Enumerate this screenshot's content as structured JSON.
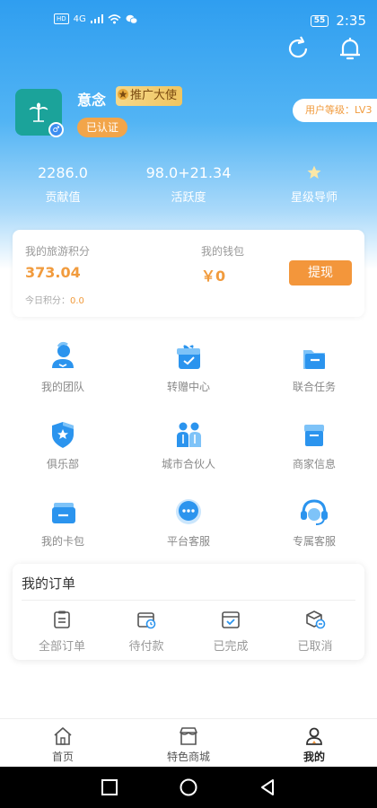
{
  "status_bar": {
    "left_badge": "HD",
    "net": "4G",
    "battery": "55",
    "time": "2:35"
  },
  "header": {
    "refresh_icon": "refresh-icon",
    "bell_icon": "bell-icon"
  },
  "profile": {
    "name": "意念",
    "promo_badge": "推广大使",
    "verified": "已认证",
    "level": "用户等级：LV3",
    "gender": "♂"
  },
  "stats": [
    {
      "value": "2286.0",
      "label": "贡献值"
    },
    {
      "value": "98.0+21.34",
      "label": "活跃度"
    },
    {
      "value": "",
      "label": "星级导师"
    }
  ],
  "wallet": {
    "points_label": "我的旅游积分",
    "points_value": "373.04",
    "wallet_label": "我的钱包",
    "wallet_value": "￥0",
    "today_label": "今日积分：",
    "today_value": "0.0",
    "withdraw": "提现"
  },
  "grid": [
    {
      "label": "我的团队",
      "icon": "team-icon"
    },
    {
      "label": "转赠中心",
      "icon": "gift-icon"
    },
    {
      "label": "联合任务",
      "icon": "folder-icon"
    },
    {
      "label": "俱乐部",
      "icon": "shield-star-icon"
    },
    {
      "label": "城市合伙人",
      "icon": "partners-icon"
    },
    {
      "label": "商家信息",
      "icon": "store-icon"
    },
    {
      "label": "我的卡包",
      "icon": "card-wallet-icon"
    },
    {
      "label": "平台客服",
      "icon": "chat-icon"
    },
    {
      "label": "专属客服",
      "icon": "headset-icon"
    }
  ],
  "orders": {
    "title": "我的订单",
    "items": [
      {
        "label": "全部订单",
        "icon": "clipboard-icon"
      },
      {
        "label": "待付款",
        "icon": "wallet-clock-icon"
      },
      {
        "label": "已完成",
        "icon": "box-check-icon"
      },
      {
        "label": "已取消",
        "icon": "box-cancel-icon"
      }
    ]
  },
  "tabbar": [
    {
      "label": "首页",
      "icon": "home-icon"
    },
    {
      "label": "特色商城",
      "icon": "shop-icon"
    },
    {
      "label": "我的",
      "icon": "user-icon",
      "active": true
    }
  ],
  "colors": {
    "accent": "#f3963b",
    "primary": "#2f9ef0",
    "icon_blue": "#2b94ee"
  }
}
